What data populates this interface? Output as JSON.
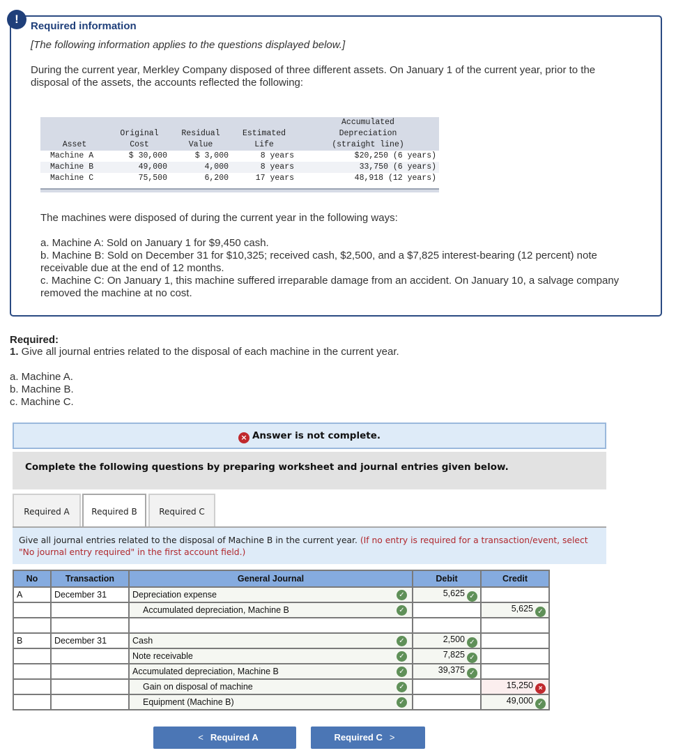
{
  "info": {
    "alert_icon": "exclamation-icon",
    "title": "Required information",
    "note": "[The following information applies to the questions displayed below.]",
    "intro": "During the current year, Merkley Company disposed of three different assets. On January 1 of the current year, prior to the disposal of the assets, the accounts reflected the following:",
    "table": {
      "headers": [
        "Asset",
        "Original Cost",
        "Residual Value",
        "Estimated Life",
        "Accumulated Depreciation (straight line)"
      ],
      "header_lines": {
        "asset": [
          "",
          "",
          "Asset"
        ],
        "cost": [
          "",
          "Original",
          "Cost"
        ],
        "residual": [
          "",
          "Residual",
          "Value"
        ],
        "life": [
          "",
          "Estimated",
          "Life"
        ],
        "accum": [
          "Accumulated",
          "Depreciation",
          "(straight line)"
        ]
      },
      "rows": [
        {
          "asset": "Machine A",
          "cost": "$ 30,000",
          "residual": "$ 3,000",
          "life": "8 years",
          "accum": "$20,250 (6 years)"
        },
        {
          "asset": "Machine B",
          "cost": "49,000",
          "residual": "4,000",
          "life": "8 years",
          "accum": "33,750 (6 years)"
        },
        {
          "asset": "Machine C",
          "cost": "75,500",
          "residual": "6,200",
          "life": "17 years",
          "accum": "48,918 (12 years)"
        }
      ]
    },
    "disposal_intro": "The machines were disposed of during the current year in the following ways:",
    "disposals": [
      "a. Machine A: Sold on January 1 for $9,450 cash.",
      "b. Machine B: Sold on December 31 for $10,325; received cash, $2,500, and a $7,825 interest-bearing (12 percent) note receivable due at the end of 12 months.",
      "c. Machine C: On January 1, this machine suffered irreparable damage from an accident. On January 10, a salvage company removed the machine at no cost."
    ]
  },
  "required": {
    "heading": "Required:",
    "question_num": "1.",
    "question": " Give all journal entries related to the disposal of each machine in the current year.",
    "items": [
      "a. Machine A.",
      "b. Machine B.",
      "c. Machine C."
    ]
  },
  "status": {
    "message": "Answer is not complete.",
    "icon": "x-circle-icon"
  },
  "instructions": "Complete the following questions by preparing worksheet and journal entries given below.",
  "tabs": [
    {
      "label": "Required A",
      "active": false
    },
    {
      "label": "Required B",
      "active": true
    },
    {
      "label": "Required C",
      "active": false
    }
  ],
  "prompt": {
    "text": "Give all journal entries related to the disposal of Machine B in the current year.",
    "hint": "(If no entry is required for a transaction/event, select \"No journal entry required\" in the first account field.)"
  },
  "journal": {
    "headers": {
      "no": "No",
      "transaction": "Transaction",
      "general_journal": "General Journal",
      "debit": "Debit",
      "credit": "Credit"
    },
    "rows": [
      {
        "no": "A",
        "transaction": "December 31",
        "account": "Depreciation expense",
        "debit": "5,625",
        "credit": ""
      },
      {
        "no": "",
        "transaction": "",
        "account": "Accumulated depreciation, Machine B",
        "debit": "",
        "credit": "5,625"
      },
      {
        "no": "",
        "transaction": "",
        "account": "",
        "debit": "",
        "credit": ""
      },
      {
        "no": "B",
        "transaction": "December 31",
        "account": "Cash",
        "debit": "2,500",
        "credit": ""
      },
      {
        "no": "",
        "transaction": "",
        "account": "Note receivable",
        "debit": "7,825",
        "credit": ""
      },
      {
        "no": "",
        "transaction": "",
        "account": "Accumulated depreciation, Machine B",
        "debit": "39,375",
        "credit": ""
      },
      {
        "no": "",
        "transaction": "",
        "account": "Gain on disposal of machine",
        "debit": "",
        "credit": "15,250",
        "credit_status": "incorrect"
      },
      {
        "no": "",
        "transaction": "",
        "account": "Equipment (Machine B)",
        "debit": "",
        "credit": "49,000"
      }
    ]
  },
  "nav": {
    "prev_label": "Required A",
    "next_label": "Required C",
    "prev_arrow": "<",
    "next_arrow": ">"
  },
  "glyphs": {
    "check": "✓",
    "x": "×",
    "exclaim": "!"
  },
  "colors": {
    "brand_dark": "#1f3f7a",
    "correct": "#5f9058",
    "incorrect": "#c0282d",
    "header_blue": "#85abdf",
    "button_blue": "#4b76b5"
  }
}
